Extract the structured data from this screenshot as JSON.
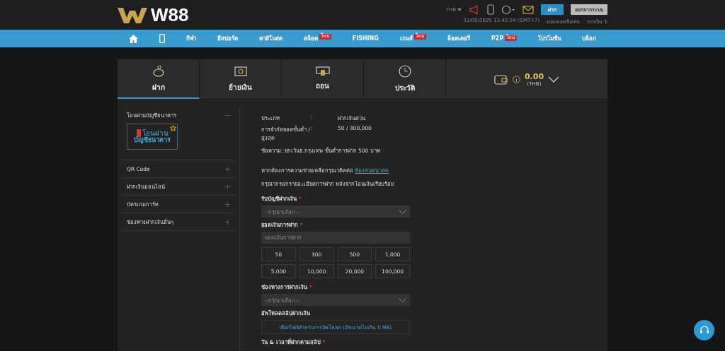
{
  "header": {
    "logo": "W88",
    "currency": "THB",
    "deposit_button": "ฝาก",
    "logout_button": "ออกจากระบบ",
    "datetime": "31/05/2025 13:42:24 (GMT+7)",
    "balance_link": "ยอดคงเหลือเล่น",
    "finance_link": "การเงิน $"
  },
  "nav": [
    {
      "kind": "home"
    },
    {
      "kind": "mobile"
    },
    {
      "kind": "text",
      "label": "กีฬา"
    },
    {
      "kind": "text",
      "label": "อีสปอร์ต"
    },
    {
      "kind": "text",
      "label": "คาสิโนสด"
    },
    {
      "kind": "text",
      "label": "สล็อต",
      "badge": "ใหม่"
    },
    {
      "kind": "text",
      "label": "FISHING"
    },
    {
      "kind": "text",
      "label": "เกมส์",
      "badge": "ใหม่"
    },
    {
      "kind": "text",
      "label": "ล็อตเตอรี่"
    },
    {
      "kind": "text",
      "label": "P2P",
      "badge": "ใหม่"
    },
    {
      "kind": "text",
      "label": "โปรโมชั่น"
    },
    {
      "kind": "text",
      "label": "บล็อก"
    }
  ],
  "tabs": [
    {
      "kind": "piggy",
      "label": "ฝาก",
      "selected": true
    },
    {
      "kind": "transfer",
      "label": "ย้ายเงิน",
      "selected": false
    },
    {
      "kind": "cash",
      "label": "ถอน",
      "selected": false
    },
    {
      "kind": "history",
      "label": "ประวัติ",
      "selected": false
    }
  ],
  "wallet": {
    "amount": "0.00",
    "currency": "(THB)"
  },
  "methods": [
    {
      "label": "โอนผ่านบัญชีธนาคาร",
      "expanded": true,
      "option": [
        "โอนผ่าน",
        "บัญชีธนาคาร"
      ]
    },
    {
      "label": "QR Code",
      "expanded": false
    },
    {
      "label": "ฝากเงินออนไลน์",
      "expanded": false
    },
    {
      "label": "บัตรเกมการ์ด",
      "expanded": false
    },
    {
      "label": "ช่องทางฝากเงินอื่นๆ",
      "expanded": false
    }
  ],
  "info": [
    {
      "label": "ประเภท",
      "sep": ":",
      "value": "ฝากเงินด่วน"
    },
    {
      "label": "การจำกัดยอดขั้นต่ำ / สูงสุด",
      "sep": ":",
      "value": "50 / 300,000"
    }
  ],
  "note": "ข้อความ: ยกเว้นธ.กรุงเทพ ขั้นต่ำการฝาก 500 บาท",
  "help": {
    "text": "หากต้องการความช่วยเหลือกรุณาติดต่อ",
    "link": "ห้องสนทนาสด"
  },
  "instruction": "กรุณากรอกรายละเอียดการฝาก หลังจากโอนเงินเรียบร้อย",
  "account_field": {
    "label": "รับบัญชีฝากเงิน",
    "required": "*",
    "placeholder": "--กรุณาเลือก--"
  },
  "amount_field": {
    "label": "ยอดเงินการฝาก",
    "required": "*",
    "placeholder": "ยอดเงินการฝาก"
  },
  "amounts": [
    "50",
    "300",
    "500",
    "1,000",
    "5,000",
    "10,000",
    "20,000",
    "100,000"
  ],
  "channel_field": {
    "label": "ช่องทางการฝากเงิน",
    "required": "*",
    "placeholder": "--กรุณาเลือก--"
  },
  "upload": {
    "label": "อัพโหลดสลิปฝากเงิน",
    "button": "เลือกไฟล์สำหรับการอัพโหลด (มีขนาดไม่เกิน 5 MB)"
  },
  "datetime_field": {
    "label": "วัน & เวลาที่ฝากตามสลิป",
    "required": "*"
  }
}
